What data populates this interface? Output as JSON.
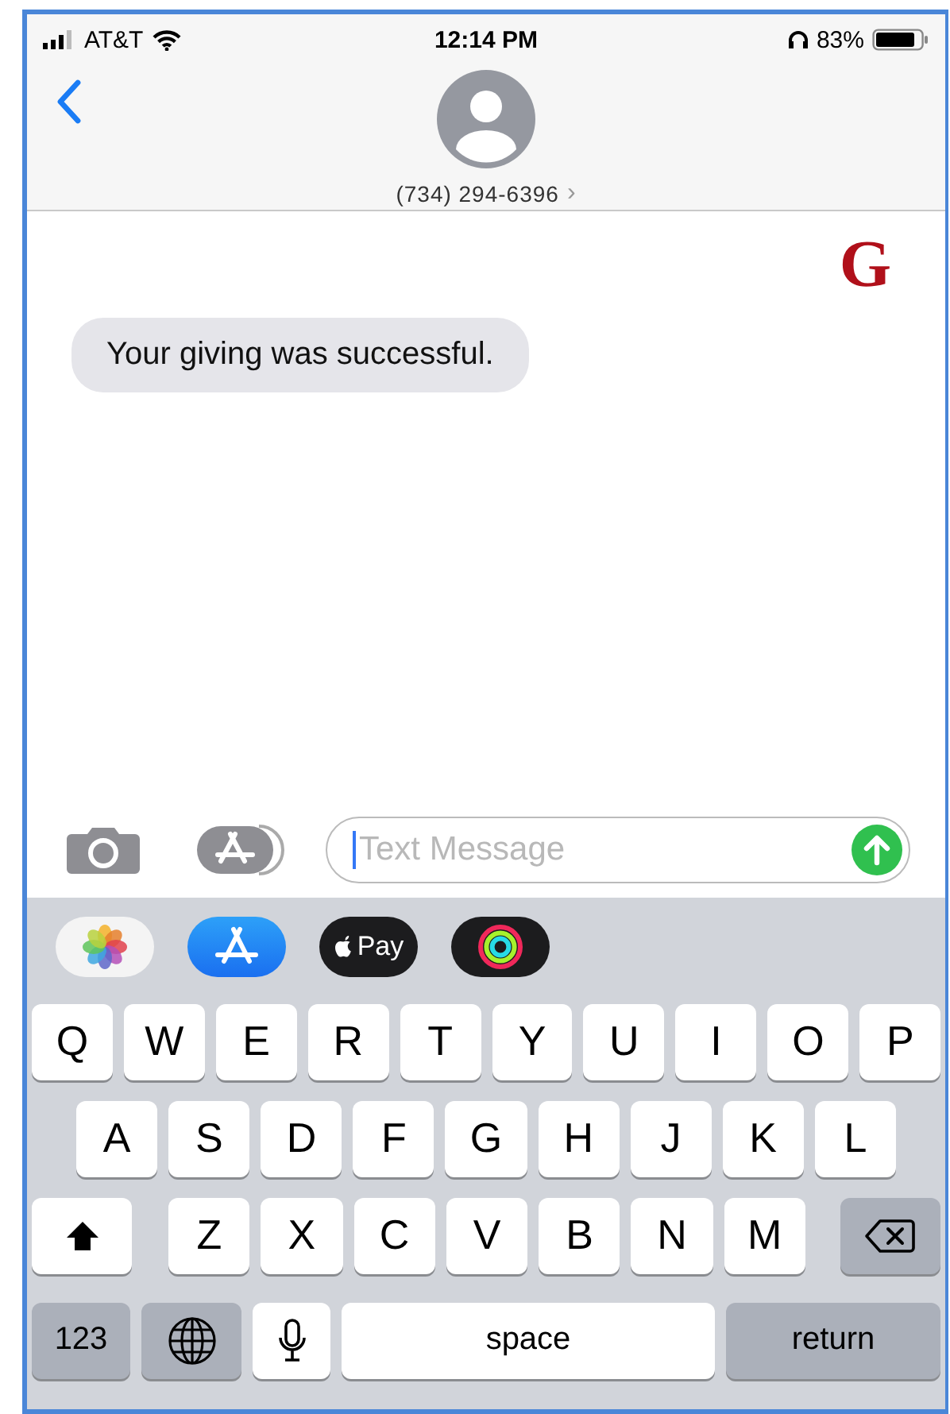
{
  "status_bar": {
    "carrier": "AT&T",
    "time": "12:14 PM",
    "battery": "83%"
  },
  "header": {
    "contact": "(734) 294-6396",
    "chevron": "›"
  },
  "figure_label": "G",
  "messages": [
    {
      "text": "Your giving was successful.",
      "kind": "received"
    }
  ],
  "composer": {
    "placeholder": "Text Message"
  },
  "apps": [
    {
      "kind": "photos"
    },
    {
      "kind": "appstore"
    },
    {
      "kind": "pay",
      "label": "Pay"
    },
    {
      "kind": "activity"
    }
  ],
  "keyboard": [
    [
      {
        "kind": "letter",
        "label": "Q"
      },
      {
        "kind": "letter",
        "label": "W"
      },
      {
        "kind": "letter",
        "label": "E"
      },
      {
        "kind": "letter",
        "label": "R"
      },
      {
        "kind": "letter",
        "label": "T"
      },
      {
        "kind": "letter",
        "label": "Y"
      },
      {
        "kind": "letter",
        "label": "U"
      },
      {
        "kind": "letter",
        "label": "I"
      },
      {
        "kind": "letter",
        "label": "O"
      },
      {
        "kind": "letter",
        "label": "P"
      }
    ],
    [
      {
        "kind": "letter",
        "label": "A"
      },
      {
        "kind": "letter",
        "label": "S"
      },
      {
        "kind": "letter",
        "label": "D"
      },
      {
        "kind": "letter",
        "label": "F"
      },
      {
        "kind": "letter",
        "label": "G"
      },
      {
        "kind": "letter",
        "label": "H"
      },
      {
        "kind": "letter",
        "label": "J"
      },
      {
        "kind": "letter",
        "label": "K"
      },
      {
        "kind": "letter",
        "label": "L"
      }
    ],
    [
      {
        "kind": "shift"
      },
      {
        "kind": "letter",
        "label": "Z"
      },
      {
        "kind": "letter",
        "label": "X"
      },
      {
        "kind": "letter",
        "label": "C"
      },
      {
        "kind": "letter",
        "label": "V"
      },
      {
        "kind": "letter",
        "label": "B"
      },
      {
        "kind": "letter",
        "label": "N"
      },
      {
        "kind": "letter",
        "label": "M"
      },
      {
        "kind": "delete"
      }
    ],
    [
      {
        "kind": "numbers",
        "label": "123"
      },
      {
        "kind": "globe"
      },
      {
        "kind": "mic"
      },
      {
        "kind": "space",
        "label": "space"
      },
      {
        "kind": "return",
        "label": "return"
      }
    ]
  ]
}
